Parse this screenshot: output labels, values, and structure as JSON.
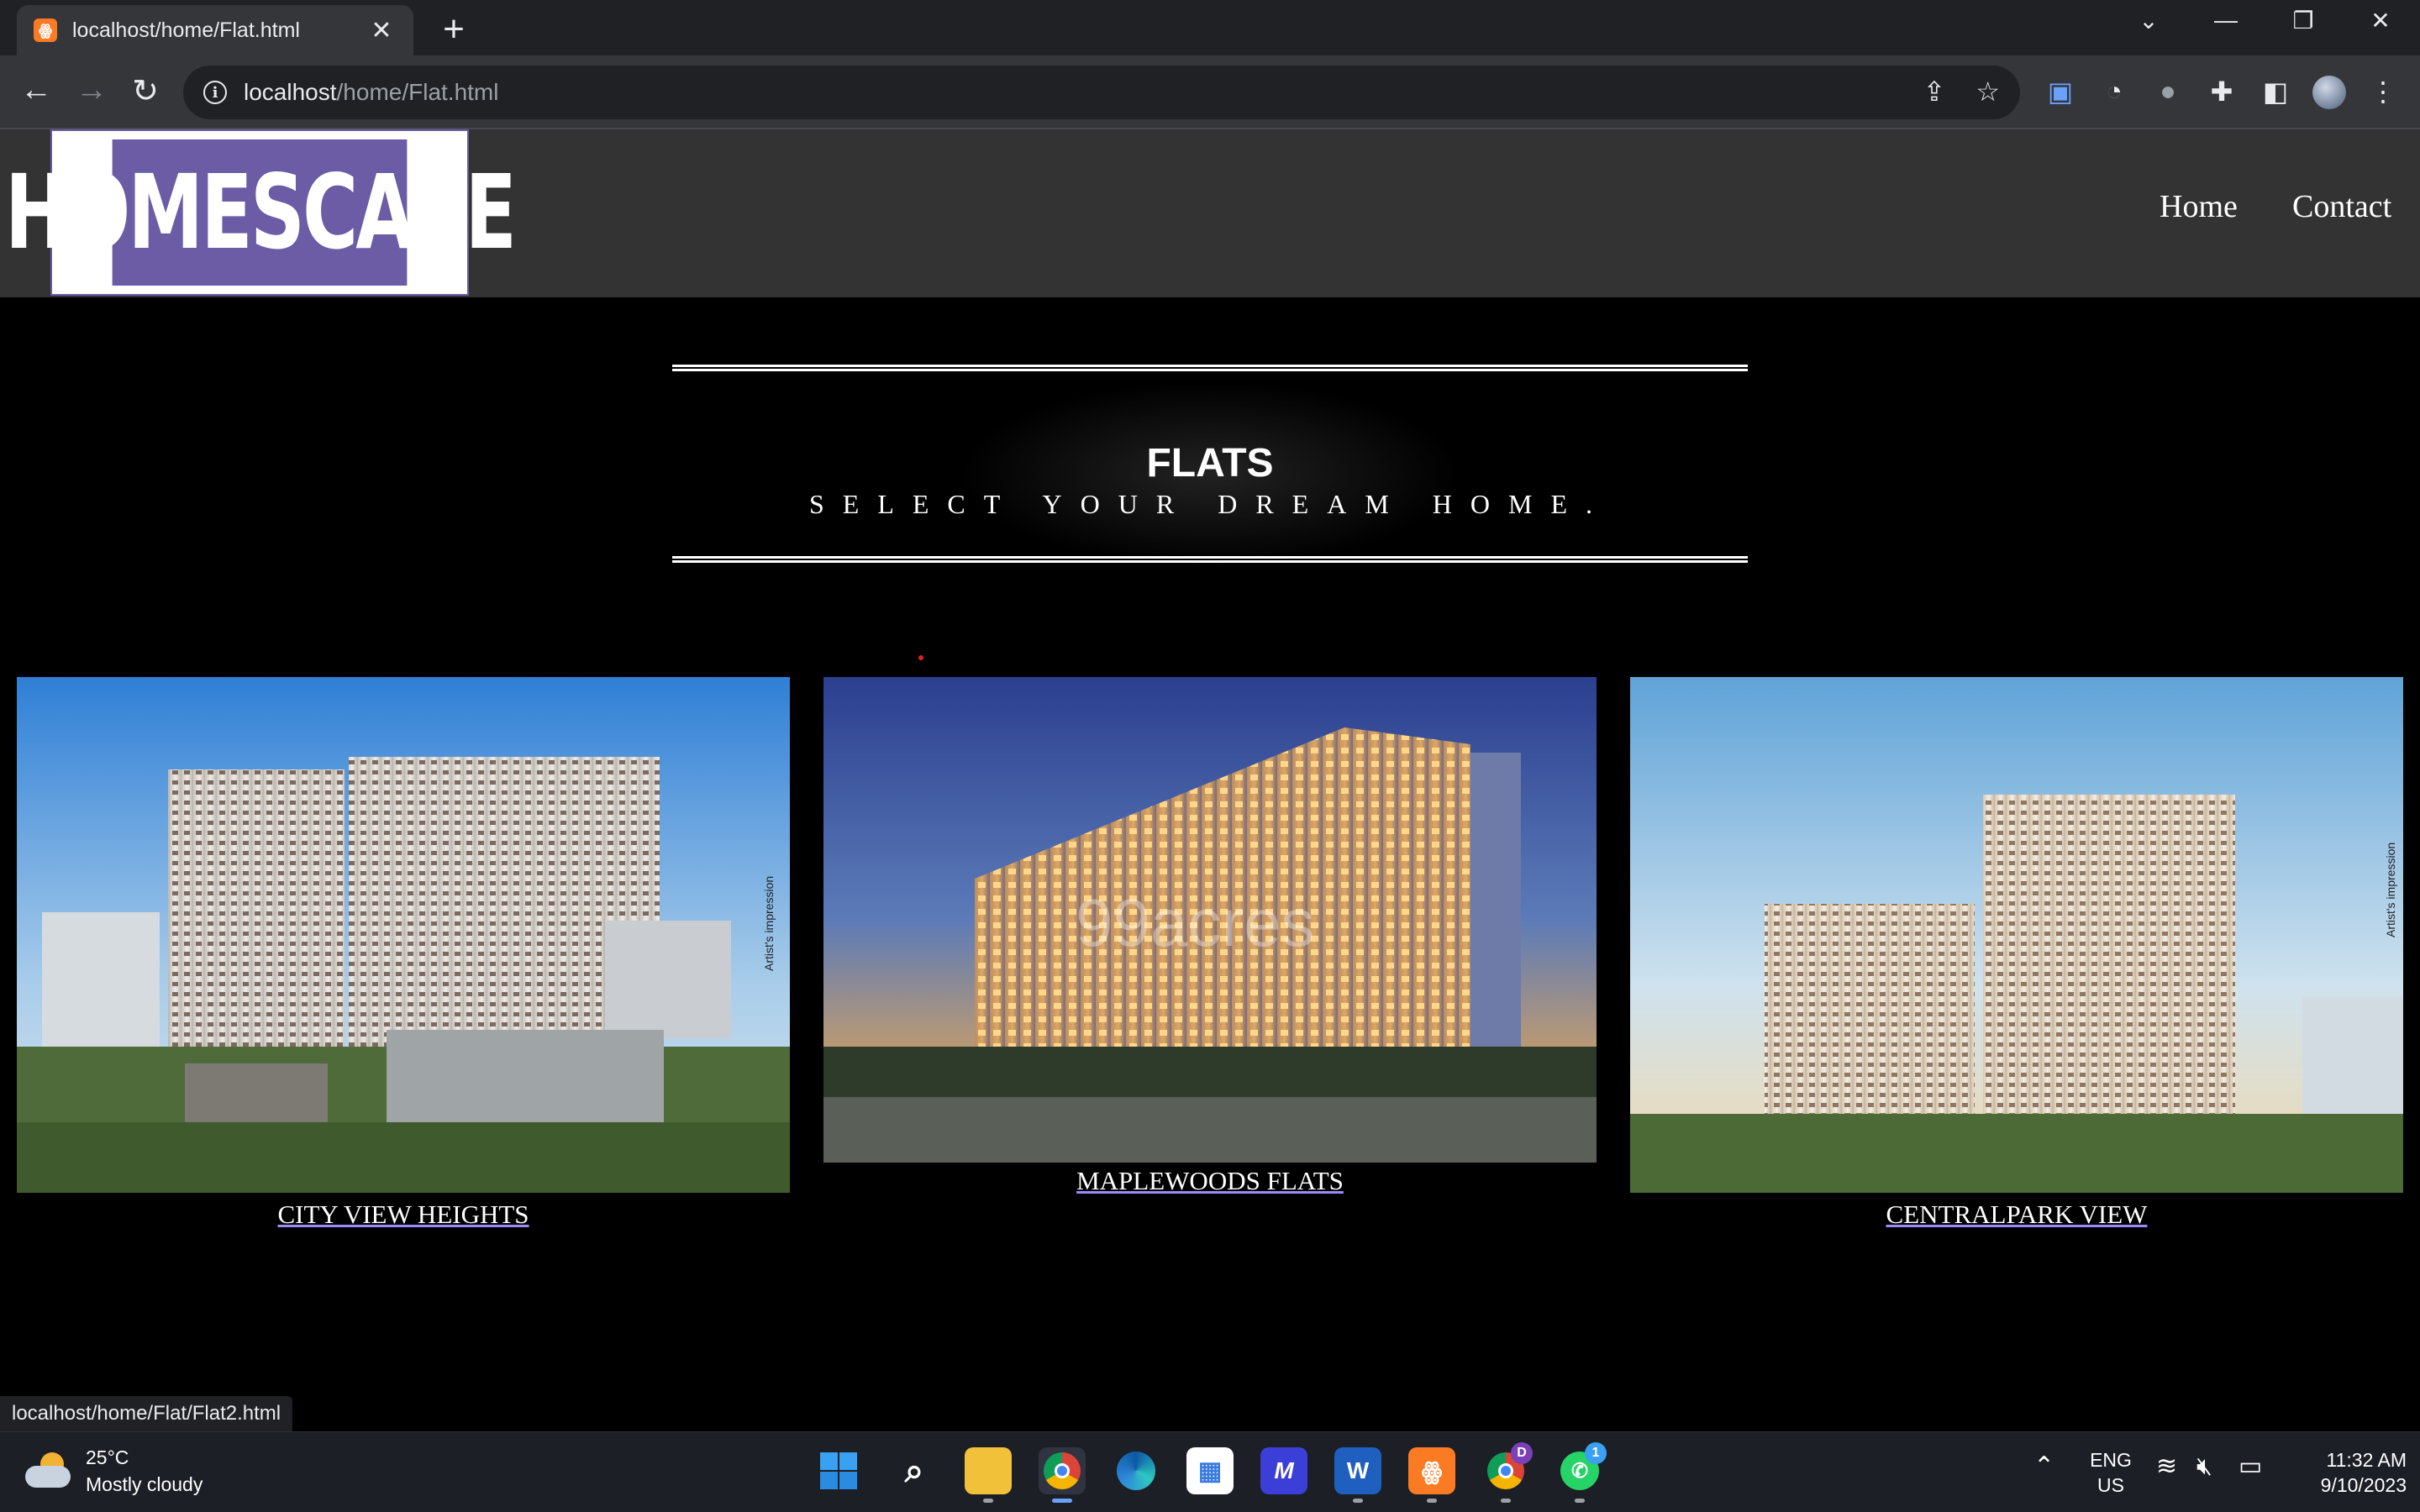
{
  "browser": {
    "tab_title": "localhost/home/Flat.html",
    "url_host": "localhost",
    "url_path": "/home/Flat.html",
    "status_url": "localhost/home/Flat/Flat2.html"
  },
  "site": {
    "logo_text": "HOMESCAPE",
    "nav": [
      "Home",
      "Contact"
    ],
    "title": "FLATS",
    "subtitle": "SELECT YOUR DREAM HOME.",
    "cards": [
      {
        "caption": "CITY VIEW HEIGHTS"
      },
      {
        "caption": "MAPLEWOODS FLATS"
      },
      {
        "caption": "CENTRALPARK VIEW"
      }
    ],
    "image_watermarks": [
      "Artist's impression",
      "99acres"
    ]
  },
  "taskbar": {
    "temperature": "25°C",
    "condition": "Mostly cloudy",
    "lang_line1": "ENG",
    "lang_line2": "US",
    "time": "11:32 AM",
    "date": "9/10/2023",
    "whatsapp_badge": "1",
    "chrome_profile_badge": "D"
  },
  "colors": {
    "header_bg": "#333333",
    "logo_purple": "#6b5ca5",
    "page_bg": "#000000",
    "link_underline": "#9a8cff"
  }
}
